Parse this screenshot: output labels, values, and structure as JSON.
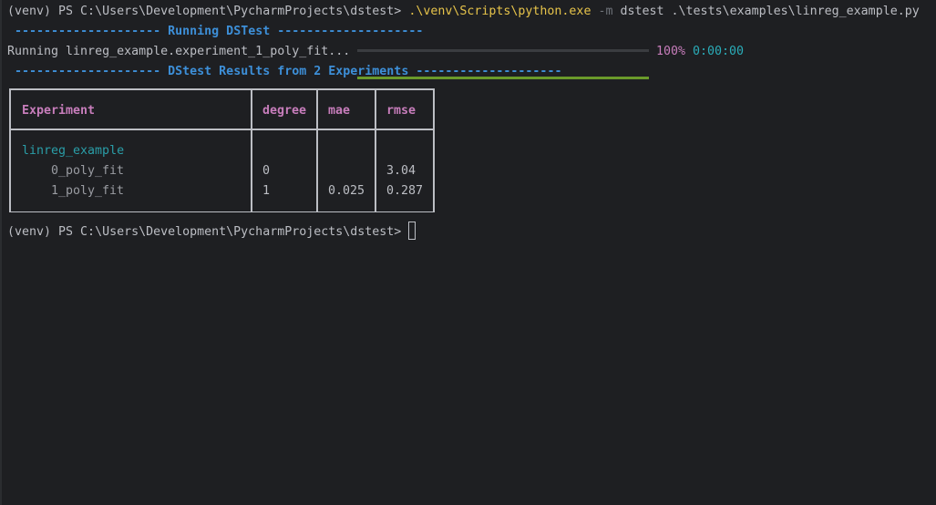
{
  "prompt": "(venv) PS C:\\Users\\Development\\PycharmProjects\\dstest>",
  "command": {
    "exe": ".\\venv\\Scripts\\python.exe",
    "flag": "-m",
    "rest": "dstest .\\tests\\examples\\linreg_example.py"
  },
  "running_banner": {
    "rule_left": "--------------------",
    "title": "Running DSTest",
    "rule_right": "--------------------"
  },
  "progress": {
    "label": "Running linreg_example.experiment_1_poly_fit...",
    "percent_text": "100%",
    "fraction": 1.0,
    "elapsed": "0:00:00"
  },
  "results_banner": {
    "rule_left": "--------------------",
    "title": "DStest Results from 2 Experiments",
    "rule_right": "--------------------"
  },
  "table": {
    "headers": [
      "Experiment",
      "degree",
      "mae",
      "rmse"
    ],
    "group": "linreg_example",
    "rows": [
      {
        "experiment": "0_poly_fit",
        "degree": "0",
        "mae": "",
        "rmse": "3.04"
      },
      {
        "experiment": "1_poly_fit",
        "degree": "1",
        "mae": "0.025",
        "rmse": "0.287"
      }
    ]
  },
  "final_prompt": "(venv) PS C:\\Users\\Development\\PycharmProjects\\dstest>",
  "colors": {
    "background": "#1e1f22",
    "text": "#bcbec4",
    "exe": "#e6c34a",
    "banner": "#3d8fd8",
    "header": "#c77dbb",
    "group": "#2aacb8",
    "progress_bar": "#6a9a2a"
  }
}
